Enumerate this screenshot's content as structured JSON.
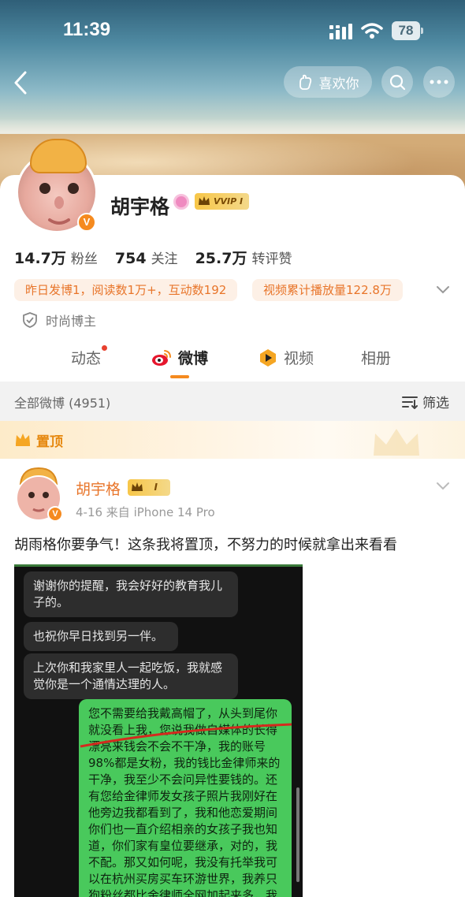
{
  "status_bar": {
    "time": "11:39",
    "battery": "78"
  },
  "nav": {
    "like_label": "喜欢你"
  },
  "profile": {
    "name": "胡宇格",
    "vip_label": "VVIP I",
    "stats": [
      {
        "value": "14.7万",
        "label": "粉丝"
      },
      {
        "value": "754",
        "label": "关注"
      },
      {
        "value": "25.7万",
        "label": "转评赞"
      }
    ],
    "highlights": [
      "昨日发博1，阅读数1万+，互动数192",
      "视频累计播放量122.8万"
    ],
    "tag": "时尚博主"
  },
  "tabs": [
    {
      "label": "动态"
    },
    {
      "label": "微博"
    },
    {
      "label": "视频"
    },
    {
      "label": "相册"
    }
  ],
  "filter": {
    "count_label": "全部微博 (4951)",
    "filter_label": "筛选"
  },
  "pinned": {
    "label": "置顶"
  },
  "post": {
    "author": "胡宇格",
    "badge": "I",
    "meta": "4-16  来自 iPhone 14 Pro",
    "text": "胡雨格你要争气！这条我将置顶，不努力的时候就拿出来看看"
  },
  "chat": {
    "messages": [
      {
        "side": "left",
        "text": "谢谢你的提醒，我会好好的教育我儿子的。"
      },
      {
        "side": "left",
        "text": "也祝你早日找到另一伴。"
      },
      {
        "side": "left",
        "text": "上次你和我家里人一起吃饭，我就感觉你是一个通情达理的人。"
      },
      {
        "side": "right",
        "text": "您不需要给我戴高帽了，从头到尾你就没看上我，您说我做自媒体的长得漂亮来钱会不会不干净，我的账号98%都是女粉，我的钱比金律师来的干净，我至少不会问异性要钱的。还有您给金律师发女孩子照片我刚好在他旁边我都看到了，我和他恋爱期间你们也一直介绍相亲的女孩子我也知道，你们家有皇位要继承，对的，我不配。那又如何呢，我没有托举我可以在杭州买房买车环游世界，我养只狗粉丝都比金律师全网加起来多，我就是让"
      }
    ]
  },
  "colors": {
    "accent": "#f58a1f",
    "highlight_text": "#e8752a",
    "bubble_green": "#49c95c"
  }
}
